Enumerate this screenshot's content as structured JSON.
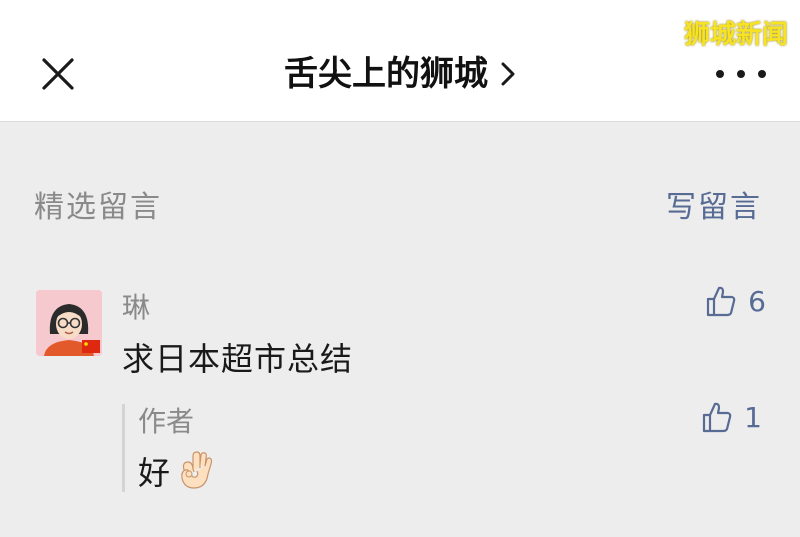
{
  "header": {
    "title": "舌尖上的狮城",
    "watermark": "狮城新闻"
  },
  "section": {
    "title": "精选留言",
    "write_link": "写留言"
  },
  "comments": [
    {
      "name": "琳",
      "text": "求日本超市总结",
      "likes": "6",
      "reply": {
        "name": "作者",
        "text": "好",
        "likes": "1"
      }
    }
  ],
  "colors": {
    "link_blue": "#576b95",
    "background": "#ededed",
    "secondary_text": "#8a8a8a"
  },
  "icons": [
    "close-icon",
    "chevron-right-icon",
    "more-icon",
    "thumbs-up-icon",
    "ok-hand-emoji"
  ]
}
